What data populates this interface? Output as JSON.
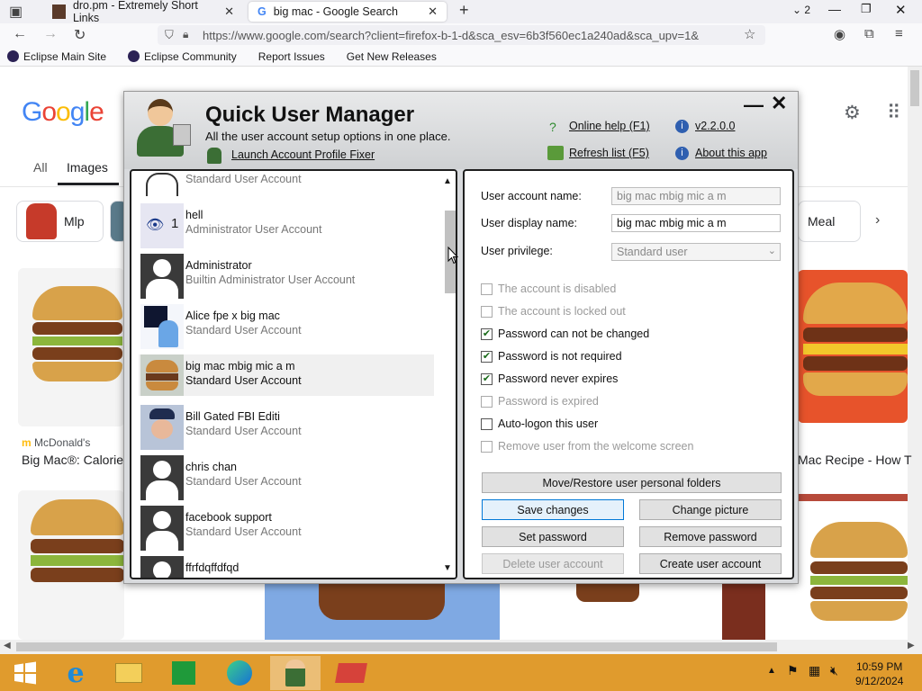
{
  "browser": {
    "tabs": [
      {
        "title": "dro.pm - Extremely Short Links",
        "close": "✕"
      },
      {
        "title": "big mac - Google Search",
        "close": "✕"
      }
    ],
    "new_tab": "+",
    "tab_count": "2",
    "url": "https://www.google.com/search?client=firefox-b-1-d&sca_esv=6b3f560ec1a240ad&sca_upv=1&",
    "bookmarks": [
      "Eclipse Main Site",
      "Eclipse Community",
      "Report Issues",
      "Get New Releases"
    ]
  },
  "google": {
    "tabs": [
      "All",
      "Images"
    ],
    "chips": [
      "Mlp",
      "Meal"
    ],
    "result_source": "McDonald's",
    "result_title_left": "Big Mac®: Calorie",
    "result_title_right": "Mac Recipe - How T"
  },
  "dialog": {
    "title": "Quick User Manager",
    "subtitle": "All the user account setup options in one place.",
    "launch_link": "Launch Account Profile Fixer",
    "links": {
      "help": "Online help (F1)",
      "version": "v2.2.0.0",
      "refresh": "Refresh list (F5)",
      "about": "About this app"
    },
    "users": [
      {
        "name": "",
        "type": "Standard User Account"
      },
      {
        "name": "hell",
        "type": "Administrator User Account"
      },
      {
        "name": "Administrator",
        "type": "Builtin Administrator User Account"
      },
      {
        "name": "Alice fpe x big mac",
        "type": "Standard User Account"
      },
      {
        "name": "big mac mbig mic a m",
        "type": "Standard User Account"
      },
      {
        "name": "Bill Gated FBI Editi",
        "type": "Standard User Account"
      },
      {
        "name": "chris chan",
        "type": "Standard User Account"
      },
      {
        "name": "facebook support",
        "type": "Standard User Account"
      },
      {
        "name": "ffrfdqffdfqd",
        "type": ""
      }
    ],
    "form": {
      "account_name_label": "User account name:",
      "account_name_value": "big mac mbig mic a m",
      "display_name_label": "User display name:",
      "display_name_value": "big mac mbig mic a m",
      "privilege_label": "User privilege:",
      "privilege_value": "Standard user"
    },
    "checkboxes": [
      {
        "label": "The account is disabled",
        "checked": false,
        "enabled": false
      },
      {
        "label": "The account is locked out",
        "checked": false,
        "enabled": false
      },
      {
        "label": "Password can not be changed",
        "checked": true,
        "enabled": true
      },
      {
        "label": "Password is not required",
        "checked": true,
        "enabled": true
      },
      {
        "label": "Password never expires",
        "checked": true,
        "enabled": true
      },
      {
        "label": "Password is expired",
        "checked": false,
        "enabled": false
      },
      {
        "label": "Auto-logon this user",
        "checked": false,
        "enabled": true
      },
      {
        "label": "Remove user from the welcome screen",
        "checked": false,
        "enabled": false
      }
    ],
    "buttons": {
      "move_restore": "Move/Restore user personal folders",
      "save": "Save changes",
      "change_picture": "Change picture",
      "set_password": "Set password",
      "remove_password": "Remove password",
      "delete_user": "Delete user account",
      "create_user": "Create user account"
    },
    "minimize": "—",
    "close": "✕"
  },
  "taskbar": {
    "time": "10:59 PM",
    "date": "9/12/2024"
  }
}
